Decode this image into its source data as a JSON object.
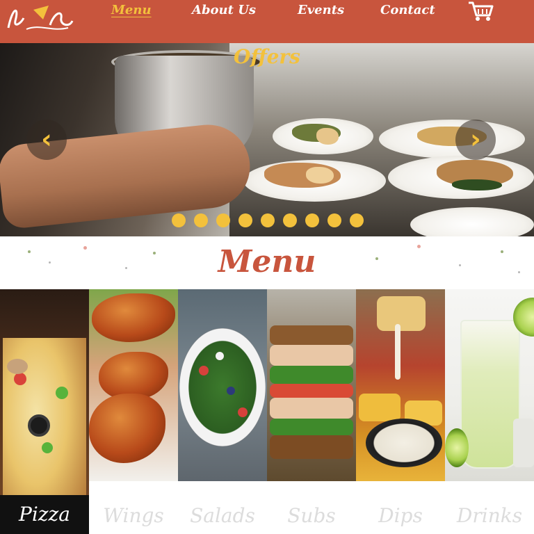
{
  "header": {
    "logo_text": "h r",
    "nav": [
      {
        "label": "Menu",
        "active": true
      },
      {
        "label": "About Us",
        "active": false
      },
      {
        "label": "Events",
        "active": false
      },
      {
        "label": "Contact",
        "active": false
      }
    ],
    "cart_icon": "shopping-cart-icon"
  },
  "carousel": {
    "title": "Offers",
    "prev_icon": "chevron-left-icon",
    "next_icon": "chevron-right-icon",
    "slide_count": 9,
    "active_slide": 0
  },
  "menu": {
    "title": "Menu",
    "selected_category": "Pizza",
    "categories": [
      "Pizza",
      "Wings",
      "Salads",
      "Subs",
      "Dips",
      "Drinks"
    ]
  },
  "colors": {
    "brand": "#c8553d",
    "accent": "#f3c13c",
    "inactive_label": "#dcdcdc"
  }
}
